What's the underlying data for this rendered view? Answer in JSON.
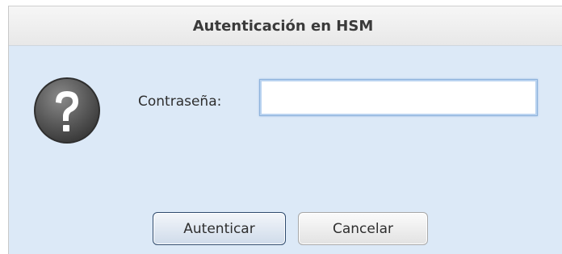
{
  "dialog": {
    "title": "Autenticación en HSM",
    "icon": "question-icon",
    "password_label": "Contraseña:",
    "password_value": "",
    "buttons": {
      "authenticate": "Autenticar",
      "cancel": "Cancelar"
    }
  },
  "colors": {
    "dialog_background": "#dce9f7",
    "titlebar_background": "#ececec",
    "input_focus_border": "#8fb3dc",
    "icon_gray": "#5a5a5a"
  }
}
